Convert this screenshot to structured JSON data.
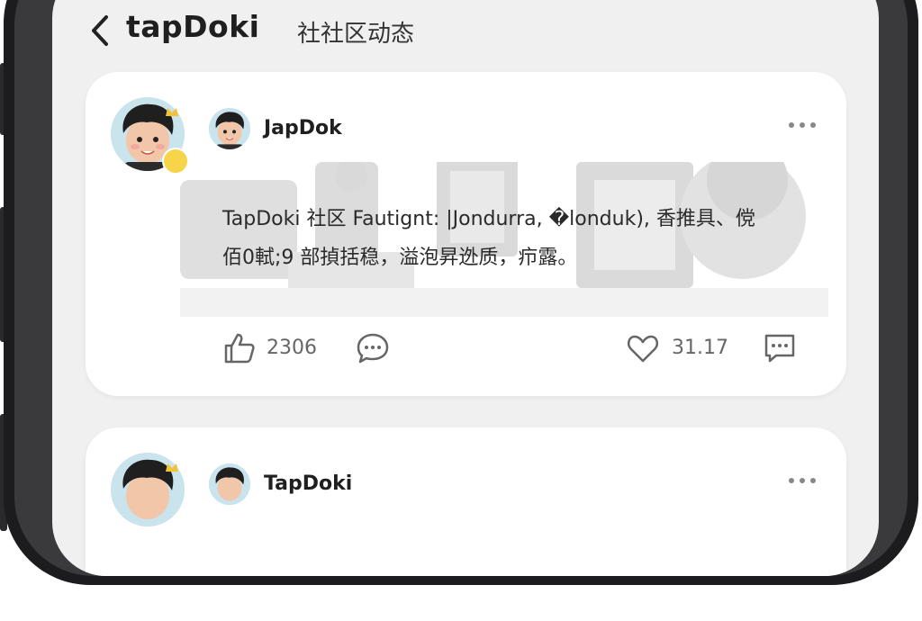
{
  "header": {
    "app_name": "tapDoki",
    "page_title": "社社区动态"
  },
  "posts": [
    {
      "username": "JapDok",
      "text_line1": "TapDoki 社区 Fautignt: |Jondurra, �londuk),  香推具、傥",
      "text_line2": "佰0軾;9 部揁括稳，溢泡昇迯质，疖露。",
      "likes": "2306",
      "favorites": "31.17"
    },
    {
      "username": "TapDoki"
    }
  ],
  "colors": {
    "screen_bg": "#f0f0f0",
    "card_bg": "#ffffff",
    "text_primary": "#1f1f1f",
    "icon": "#666666",
    "badge": "#f7d54a"
  }
}
